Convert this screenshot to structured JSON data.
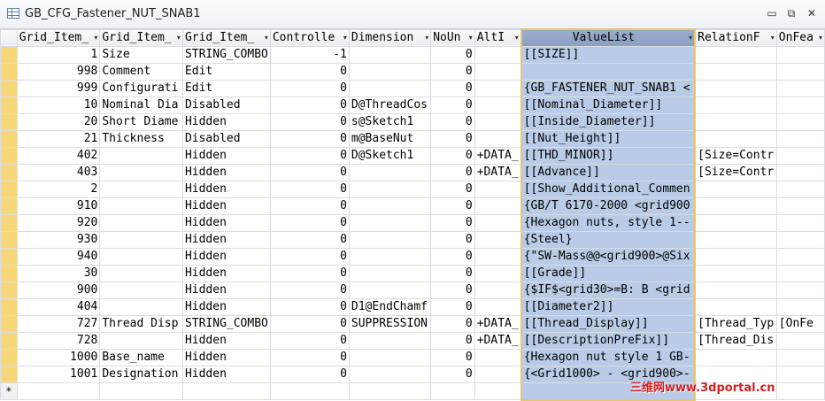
{
  "window": {
    "title": "GB_CFG_Fastener_NUT_SNAB1"
  },
  "window_buttons": {
    "minimize": "▭",
    "restore": "⧉",
    "close": "✕"
  },
  "columns": [
    "Grid_Item_",
    "Grid_Item_",
    "Grid_Item_",
    "Controlle",
    "Dimension",
    "NoUn",
    "AltI",
    "ValueList",
    "RelationF",
    "OnFea"
  ],
  "rows": [
    [
      "1",
      "Size",
      "STRING_COMBO",
      "-1",
      "",
      "0",
      "",
      "[[SIZE]]",
      "",
      ""
    ],
    [
      "998",
      "Comment",
      "Edit",
      "0",
      "",
      "0",
      "",
      "",
      "",
      ""
    ],
    [
      "999",
      "Configurati",
      "Edit",
      "0",
      "",
      "0",
      "",
      "{GB_FASTENER_NUT_SNAB1 <",
      "",
      ""
    ],
    [
      "10",
      "Nominal Dia",
      "Disabled",
      "0",
      "D@ThreadCos",
      "0",
      "",
      "[[Nominal_Diameter]]",
      "",
      ""
    ],
    [
      "20",
      "Short Diame",
      "Hidden",
      "0",
      "s@Sketch1",
      "0",
      "",
      "[[Inside_Diameter]]",
      "",
      ""
    ],
    [
      "21",
      "Thickness",
      "Disabled",
      "0",
      "m@BaseNut",
      "0",
      "",
      "[[Nut_Height]]",
      "",
      ""
    ],
    [
      "402",
      "",
      "Hidden",
      "0",
      "D@Sketch1",
      "0",
      "+DATA_",
      "[[THD_MINOR]]",
      "[Size=Contr",
      ""
    ],
    [
      "403",
      "",
      "Hidden",
      "0",
      "",
      "0",
      "+DATA_",
      "[[Advance]]",
      "[Size=Contr",
      ""
    ],
    [
      "2",
      "",
      "Hidden",
      "0",
      "",
      "0",
      "",
      "[[Show_Additional_Commen",
      "",
      ""
    ],
    [
      "910",
      "",
      "Hidden",
      "0",
      "",
      "0",
      "",
      "{GB/T 6170-2000 <grid900",
      "",
      ""
    ],
    [
      "920",
      "",
      "Hidden",
      "0",
      "",
      "0",
      "",
      "{Hexagon nuts, style 1--",
      "",
      ""
    ],
    [
      "930",
      "",
      "Hidden",
      "0",
      "",
      "0",
      "",
      "{Steel}",
      "",
      ""
    ],
    [
      "940",
      "",
      "Hidden",
      "0",
      "",
      "0",
      "",
      "{\"SW-Mass@@<grid900>@Six",
      "",
      ""
    ],
    [
      "30",
      "",
      "Hidden",
      "0",
      "",
      "0",
      "",
      "[[Grade]]",
      "",
      ""
    ],
    [
      "900",
      "",
      "Hidden",
      "0",
      "",
      "0",
      "",
      "{$IF$<grid30>=B: B <grid",
      "",
      ""
    ],
    [
      "404",
      "",
      "Hidden",
      "0",
      "D1@EndChamf",
      "0",
      "",
      "[[Diameter2]]",
      "",
      ""
    ],
    [
      "727",
      "Thread Disp",
      "STRING_COMBO",
      "0",
      "SUPPRESSION",
      "0",
      "+DATA_",
      "[[Thread_Display]]",
      "[Thread_Typ",
      "[OnFe"
    ],
    [
      "728",
      "",
      "Hidden",
      "0",
      "",
      "0",
      "+DATA_",
      "[[DescriptionPreFix]]",
      "[Thread_Dis",
      ""
    ],
    [
      "1000",
      "Base_name",
      "Hidden",
      "0",
      "",
      "0",
      "",
      "{Hexagon nut style 1 GB-",
      "",
      ""
    ],
    [
      "1001",
      "Designation",
      "Hidden",
      "0",
      "",
      "0",
      "",
      "{<Grid1000> - <grid900>-",
      "",
      ""
    ]
  ],
  "new_row_marker": "*",
  "watermark": "三维网www.3dportal.cn",
  "colors": {
    "selected_column": "#b9cbe6",
    "selector_bar": "#f7d77a",
    "selection_border": "#e9c766"
  }
}
